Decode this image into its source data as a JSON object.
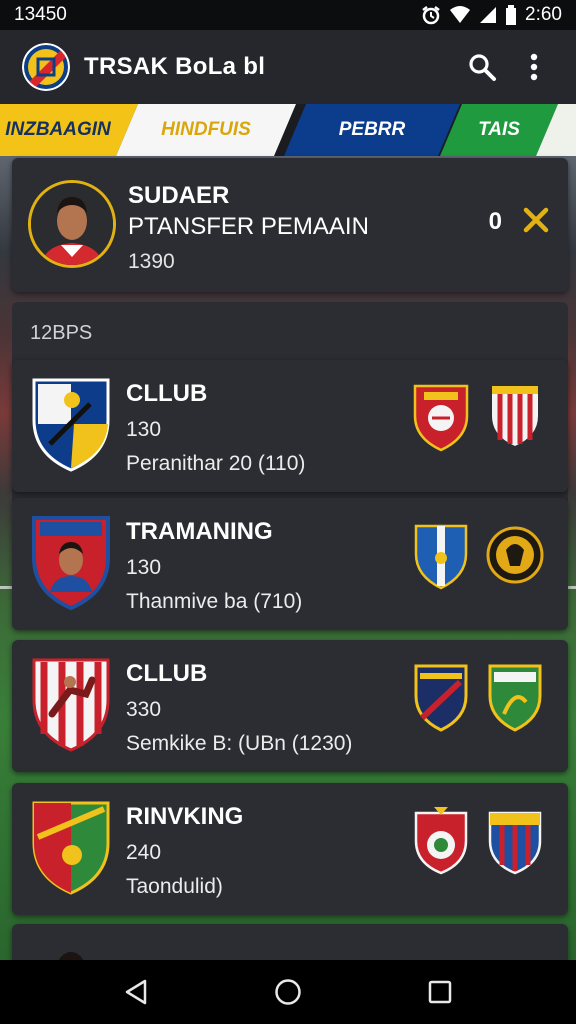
{
  "status_bar": {
    "time_left": "13450",
    "time_right": "2:60",
    "icons": [
      "alarm-icon",
      "wifi-icon",
      "signal-icon",
      "battery-icon"
    ]
  },
  "app_bar": {
    "title": "TRSAK BoLa bl",
    "logo_icon": "club-logo-icon",
    "actions": [
      "search-icon",
      "more-vert-icon"
    ]
  },
  "tabs": [
    {
      "label": "INZBAAGIN",
      "color": "#f3c417"
    },
    {
      "label": "HINDFUIS",
      "color": "#f6f6f6"
    },
    {
      "label": "PEBRR",
      "color": "#0c3c8c"
    },
    {
      "label": "TAIS",
      "color": "#1f9a3f"
    },
    {
      "label": "",
      "color": "#eef2ea"
    }
  ],
  "highlight": {
    "title": "SUDAER",
    "subtitle": "PTANSFER PEMAAIN",
    "value": "1390",
    "count": "0",
    "close_icon": "close-icon",
    "accent": "#e2b213"
  },
  "section_label": "12BPS",
  "items": [
    {
      "title": "CLLUB",
      "value": "130",
      "detail": "Peranithar 20 (110)"
    },
    {
      "title": "TRAMANING",
      "value": "130",
      "detail": "Thanmive ba (710)"
    },
    {
      "title": "CLLUB",
      "value": "330",
      "detail": "Semkike B: (UBn (1230)"
    },
    {
      "title": "RINVKING",
      "value": "240",
      "detail": "Taondulid)"
    }
  ],
  "nav": [
    "back-icon",
    "home-icon",
    "recents-icon"
  ]
}
